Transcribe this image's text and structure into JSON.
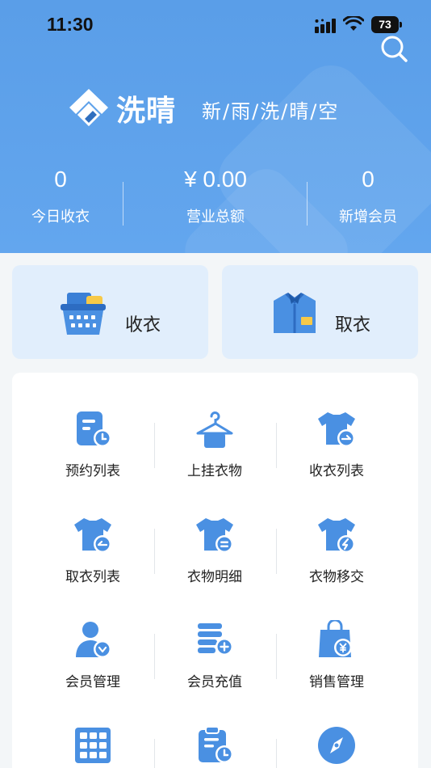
{
  "status": {
    "time": "11:30",
    "battery": "73"
  },
  "header": {
    "brand": "洗晴",
    "slogan": "新/雨/洗/晴/空",
    "stats": [
      {
        "value": "0",
        "label": "今日收衣"
      },
      {
        "value": "¥ 0.00",
        "label": "营业总额"
      },
      {
        "value": "0",
        "label": "新增会员"
      }
    ]
  },
  "actions": {
    "receive": "收衣",
    "pickup": "取衣"
  },
  "menu": [
    {
      "label": "预约列表",
      "icon": "reservation-list-icon"
    },
    {
      "label": "上挂衣物",
      "icon": "hanger-icon"
    },
    {
      "label": "收衣列表",
      "icon": "receive-list-icon"
    },
    {
      "label": "取衣列表",
      "icon": "pickup-list-icon"
    },
    {
      "label": "衣物明细",
      "icon": "clothing-detail-icon"
    },
    {
      "label": "衣物移交",
      "icon": "clothing-transfer-icon"
    },
    {
      "label": "会员管理",
      "icon": "member-management-icon"
    },
    {
      "label": "会员充值",
      "icon": "member-recharge-icon"
    },
    {
      "label": "销售管理",
      "icon": "sales-management-icon"
    },
    {
      "label": "",
      "icon": "grid-cabinet-icon"
    },
    {
      "label": "",
      "icon": "schedule-clipboard-icon"
    },
    {
      "label": "",
      "icon": "compass-icon"
    }
  ],
  "colors": {
    "accent": "#4a90e2",
    "header": "#5fa3ec",
    "card": "#e1eefc"
  }
}
